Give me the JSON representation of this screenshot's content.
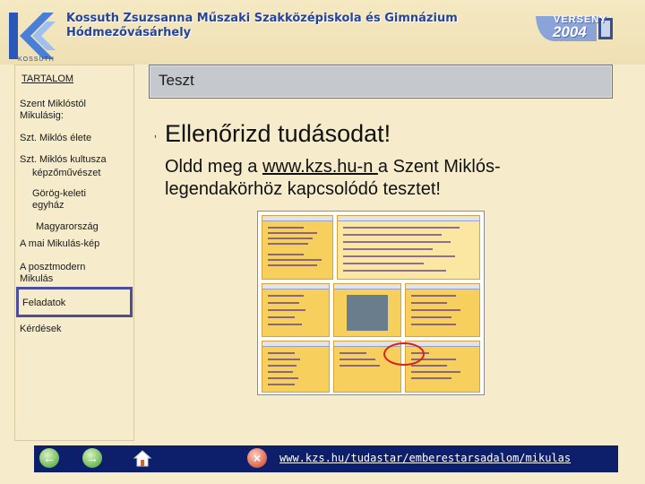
{
  "header": {
    "school_line1": "Kossuth Zsuzsanna Műszaki Szakközépiskola és Gimnázium",
    "school_line2": "Hódmezővásárhely",
    "logo_caption": "KOSSUTH",
    "verseny_label": "VERSENY",
    "verseny_year": "2004"
  },
  "sidebar": {
    "toc_title": "TARTALOM",
    "items": [
      {
        "label": "Szent Miklóstól Mikulásig:"
      },
      {
        "label": "Szt. Miklós élete"
      },
      {
        "label": "Szt. Miklós kultusza"
      },
      {
        "label": "képzőművészet"
      },
      {
        "label": "Görög-keleti egyház"
      },
      {
        "label": "Magyarország"
      },
      {
        "label": "A mai Mikulás-kép"
      },
      {
        "label": "A posztmodern Mikulás"
      },
      {
        "label": "Feladatok"
      },
      {
        "label": "Kérdések"
      }
    ]
  },
  "content": {
    "slide_title": "Teszt",
    "bullet": "’",
    "heading": "Ellenőrizd tudásodat!",
    "body_pre": "Oldd meg a ",
    "body_link": "www.kzs.hu-n ",
    "body_post": "a Szent Miklós-legendakörhöz kapcsolódó tesztet!"
  },
  "footer": {
    "url": "www.kzs.hu/tudastar/emberestarsadalom/mikulas"
  },
  "colors": {
    "background": "#f6eccc",
    "title_box": "#c5c8cd",
    "footer_bar": "#0d1f6a",
    "school_text": "#25449b",
    "highlight_circle": "#d92020"
  },
  "icons": {
    "back": "arrow-left-icon",
    "forward": "arrow-right-icon",
    "home": "home-icon",
    "close": "close-icon"
  }
}
